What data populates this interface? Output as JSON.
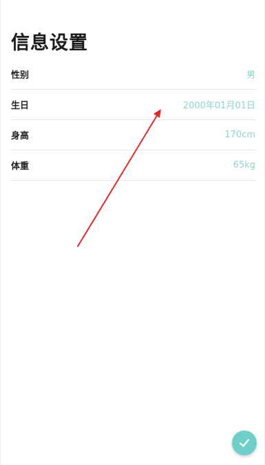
{
  "page": {
    "title": "信息设置"
  },
  "settings": [
    {
      "label": "性别",
      "value": "男"
    },
    {
      "label": "生日",
      "value": "2000年01月01日"
    },
    {
      "label": "身高",
      "value": "170cm"
    },
    {
      "label": "体重",
      "value": "65kg"
    }
  ],
  "fab": {
    "icon": "check-icon"
  },
  "annotation": {
    "icon": "red-arrow-icon",
    "color": "#e5262b"
  },
  "colors": {
    "accent": "#6ecfc8",
    "value_text": "#8fd3cf"
  }
}
